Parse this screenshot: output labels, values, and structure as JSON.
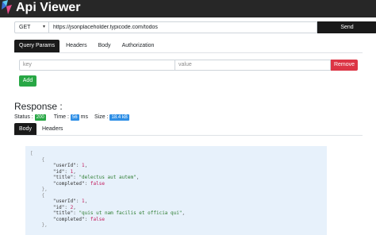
{
  "app": {
    "title": "Api Viewer"
  },
  "request": {
    "method": "GET",
    "url": "https://jsonplaceholder.typicode.com/todos",
    "send_label": "Send"
  },
  "tabs": [
    "Query Params",
    "Headers",
    "Body",
    "Authorization"
  ],
  "query_params": {
    "key_placeholder": "key",
    "value_placeholder": "value",
    "remove_label": "Remove",
    "add_label": "Add"
  },
  "response": {
    "title": "Response :",
    "status_label": "Status :",
    "status_value": "200",
    "time_label": "Time :",
    "time_value": "56",
    "time_unit": "ms",
    "size_label": "Size :",
    "size_value": "18.4 kB",
    "tabs": [
      "Body",
      "Headers"
    ],
    "todos": [
      {
        "userId": "1",
        "id": "1",
        "title": "\"delectus aut autem\"",
        "completed": "false"
      },
      {
        "userId": "1",
        "id": "2",
        "title": "\"quis ut nam facilis et officia qui\"",
        "completed": "false"
      }
    ]
  },
  "colors": {
    "topbar": "#272727",
    "primary_dark": "#1a1a1a",
    "remove": "#dc3545",
    "add": "#28a745",
    "status_badge": "#28a745",
    "info_badge": "#2f8fe6",
    "code_bg": "#e7f1fb"
  }
}
